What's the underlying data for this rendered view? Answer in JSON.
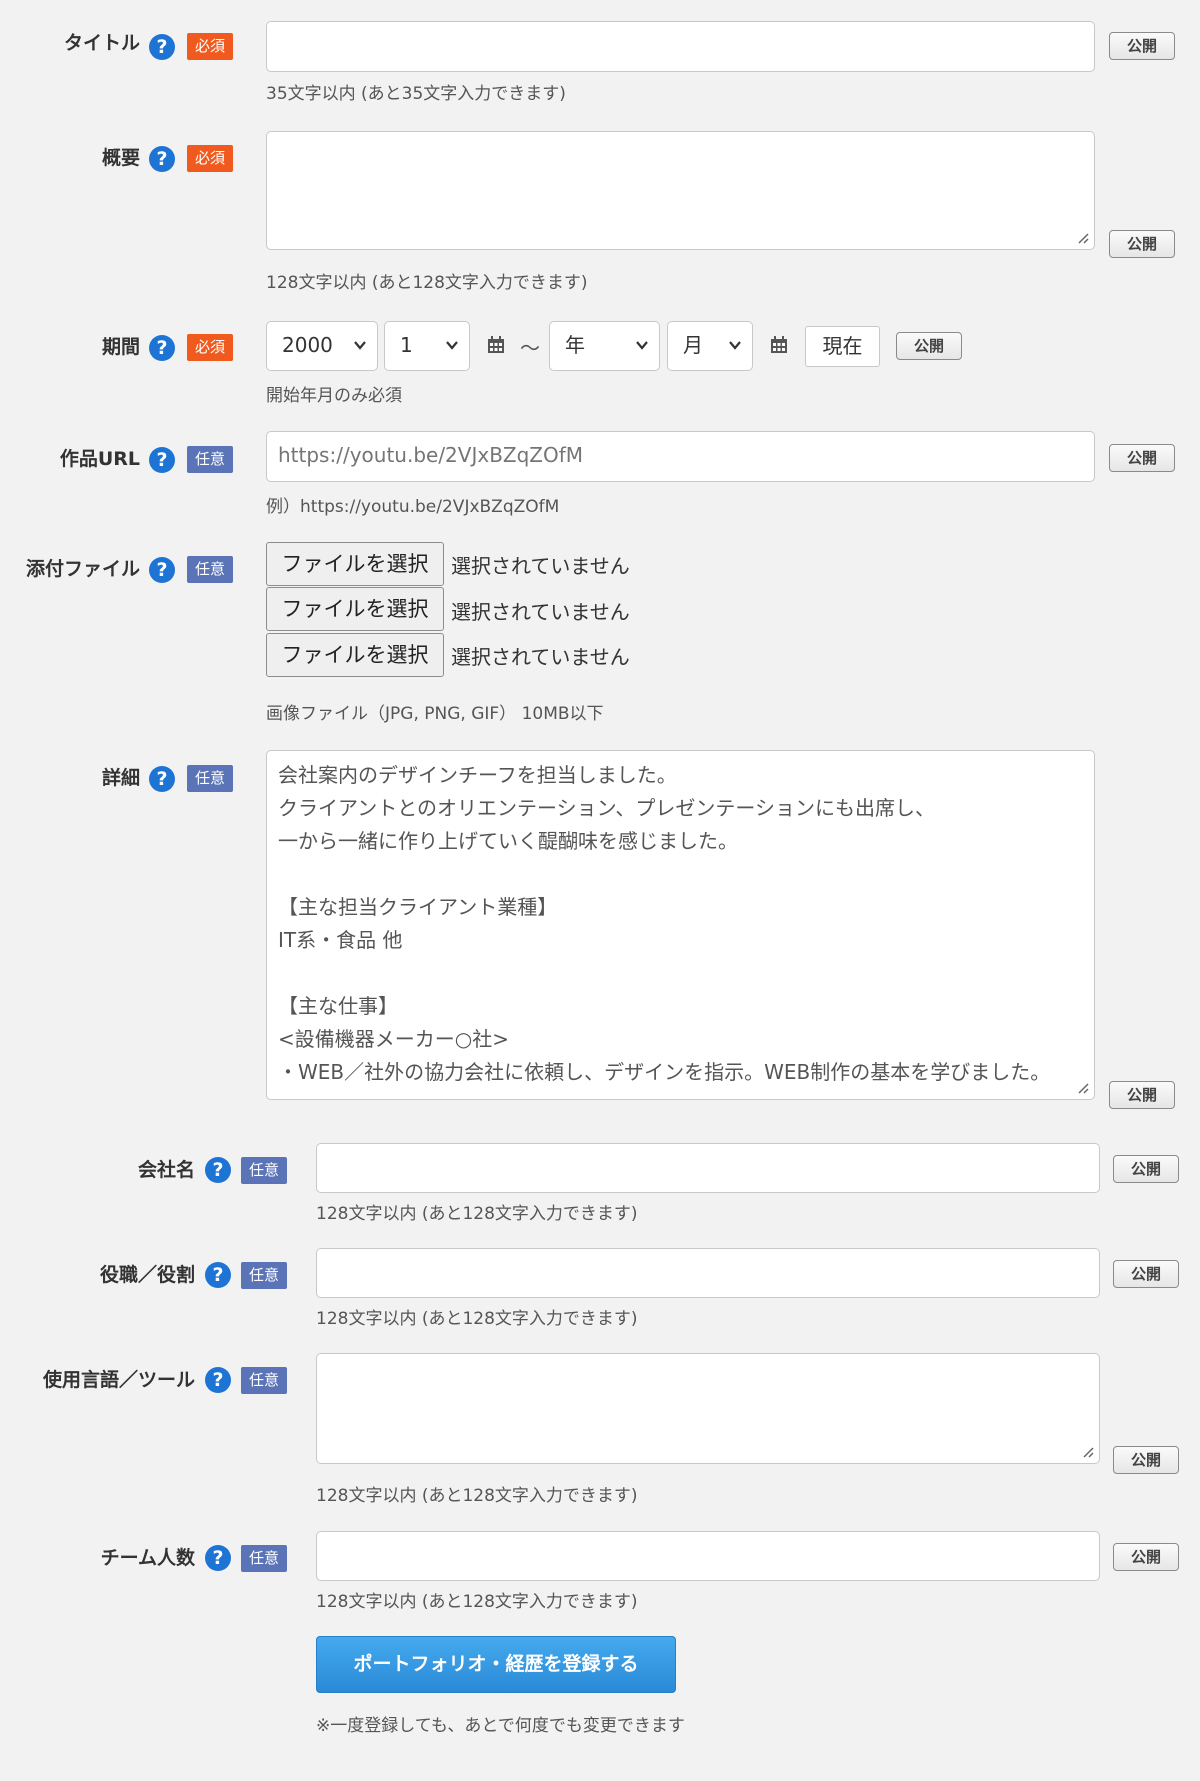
{
  "help_glyph": "?",
  "public_label": "公開",
  "required_badge": "必須",
  "optional_badge": "任意",
  "colors": {
    "required": "#f05a1e",
    "optional": "#5b74b8",
    "help": "#1e74d4",
    "submit": "#2a8ad6"
  },
  "title_field": {
    "label": "タイトル",
    "value": "",
    "hint": "35文字以内 (あと35文字入力できます)"
  },
  "summary_field": {
    "label": "概要",
    "value": "",
    "hint": "128文字以内 (あと128文字入力できます)"
  },
  "period_field": {
    "label": "期間",
    "start_year": "2000",
    "start_month": "1",
    "separator": "〜",
    "end_year": "年",
    "end_month": "月",
    "now_button": "現在",
    "hint": "開始年月のみ必須"
  },
  "url_field": {
    "label": "作品URL",
    "placeholder": "https://youtu.be/2VJxBZqZOfM",
    "hint": "例）https://youtu.be/2VJxBZqZOfM"
  },
  "attachment_field": {
    "label": "添付ファイル",
    "files": [
      {
        "button": "ファイルを選択",
        "status": "選択されていません"
      },
      {
        "button": "ファイルを選択",
        "status": "選択されていません"
      },
      {
        "button": "ファイルを選択",
        "status": "選択されていません"
      }
    ],
    "hint": "画像ファイル（JPG, PNG, GIF） 10MB以下"
  },
  "detail_field": {
    "label": "詳細",
    "value": "会社案内のデザインチーフを担当しました。\nクライアントとのオリエンテーション、プレゼンテーションにも出席し、\n一から一緒に作り上げていく醍醐味を感じました。\n\n【主な担当クライアント業種】\nIT系・食品 他\n\n【主な仕事】\n<設備機器メーカー○社>\n・WEB／社外の協力会社に依頼し、デザインを指示。WEB制作の基本を学びました。"
  },
  "company_field": {
    "label": "会社名",
    "value": "",
    "hint": "128文字以内 (あと128文字入力できます)"
  },
  "role_field": {
    "label": "役職／役割",
    "value": "",
    "hint": "128文字以内 (あと128文字入力できます)"
  },
  "tools_field": {
    "label": "使用言語／ツール",
    "value": "",
    "hint": "128文字以内 (あと128文字入力できます)"
  },
  "team_field": {
    "label": "チーム人数",
    "value": "",
    "hint": "128文字以内 (あと128文字入力できます)"
  },
  "submit": {
    "label": "ポートフォリオ・経歴を登録する",
    "note": "※一度登録しても、あとで何度でも変更できます"
  }
}
